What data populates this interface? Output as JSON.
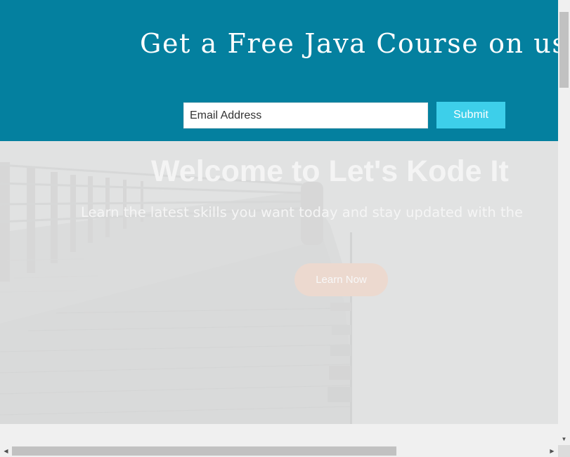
{
  "promo": {
    "title": "Get a Free Java Course on us",
    "email_placeholder": "Email Address",
    "submit_label": "Submit"
  },
  "hero": {
    "title": "Welcome to Let's Kode It",
    "subtitle": "Learn the latest skills you want today and stay updated with the",
    "cta_label": "Learn Now"
  },
  "scrollbars": {
    "vertical_down_icon": "arrow-down-icon",
    "horizontal_left_icon": "arrow-left-icon",
    "horizontal_right_icon": "arrow-right-icon"
  },
  "colors": {
    "banner_background": "#04809f",
    "submit_button": "#3dcfea",
    "learn_button": "#ecd9cf"
  }
}
